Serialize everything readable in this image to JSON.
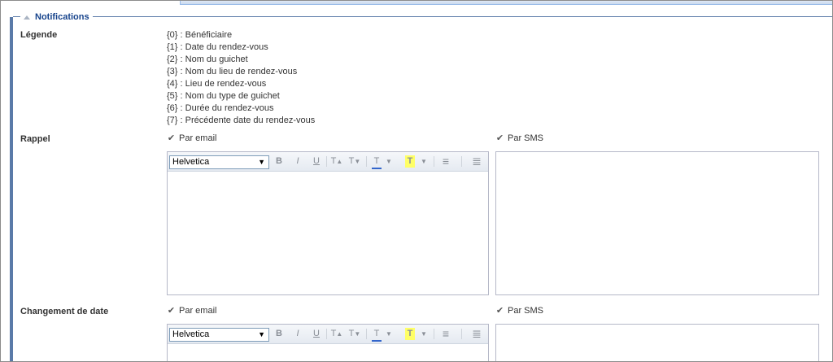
{
  "fieldset": {
    "title": "Notifications"
  },
  "legend_section": {
    "label": "Légende",
    "items": [
      "{0} : Bénéficiaire",
      "{1} : Date du rendez-vous",
      "{2} : Nom du guichet",
      "{3} : Nom du lieu de rendez-vous",
      "{4} : Lieu de rendez-vous",
      "{5} : Nom du type de guichet",
      "{6} : Durée du rendez-vous",
      "{7} : Précédente date du rendez-vous"
    ]
  },
  "rappel": {
    "label": "Rappel",
    "email_label": "Par email",
    "email_checked": true,
    "sms_label": "Par SMS",
    "sms_checked": true,
    "font": "Helvetica",
    "email_body": "",
    "sms_body": ""
  },
  "changement": {
    "label": "Changement de date",
    "email_label": "Par email",
    "email_checked": true,
    "sms_label": "Par SMS",
    "sms_checked": true,
    "font": "Helvetica",
    "email_body": "",
    "sms_body": ""
  },
  "toolbar_glyphs": {
    "font_arrow": "▼",
    "bold": "B",
    "italic": "I",
    "underline": "U",
    "grow": "T",
    "grow_mark": "▲",
    "shrink": "T",
    "shrink_mark": "▼",
    "font_color": "T",
    "highlight": "T",
    "dropdown": "▼",
    "align_left": "≡",
    "list": "≣"
  },
  "colors": {
    "accent": "#5a7aa8",
    "legend_text": "#15428b",
    "font_color_bar": "#3366cc",
    "highlight": "#ffff66"
  },
  "icons": {
    "checkbox": "checkbox-checked-icon",
    "legend_toggle": "collapse-triangle-icon"
  }
}
